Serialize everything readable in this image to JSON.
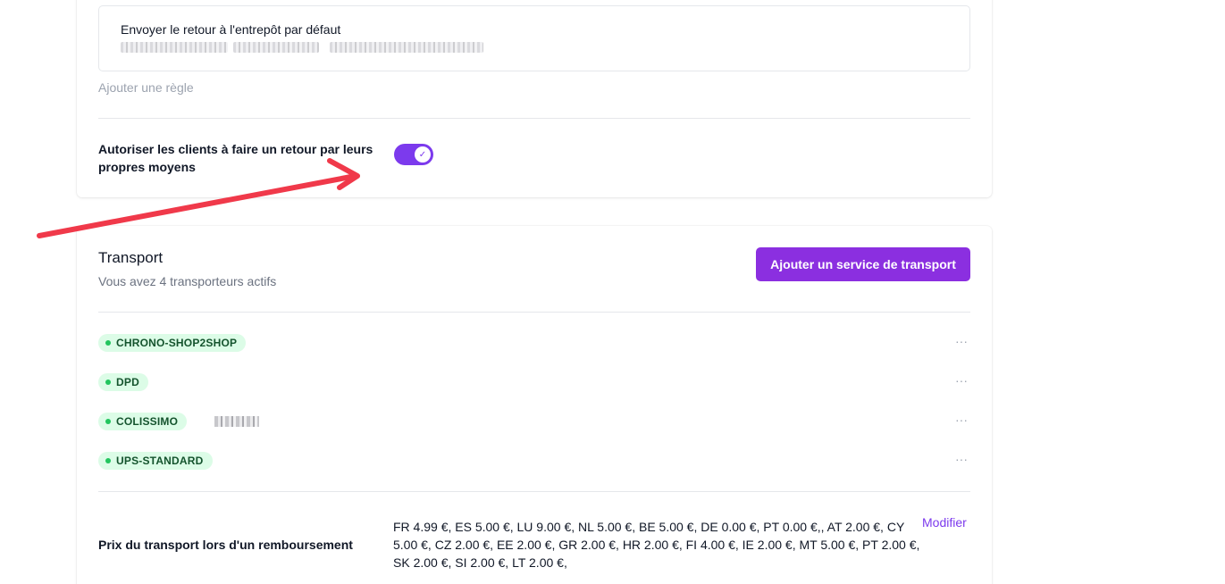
{
  "returns": {
    "rule_title": "Envoyer le retour à l'entrepôt par défaut",
    "add_rule_label": "Ajouter une règle",
    "own_means_label": "Autoriser les clients à faire un retour par leurs propres moyens",
    "own_means_enabled": true
  },
  "transport": {
    "title": "Transport",
    "subtitle": "Vous avez 4 transporteurs actifs",
    "add_button_label": "Ajouter un service de transport",
    "carriers": [
      {
        "name": "CHRONO-SHOP2SHOP",
        "more": "···"
      },
      {
        "name": "DPD",
        "more": "···"
      },
      {
        "name": "COLISSIMO",
        "more": "···"
      },
      {
        "name": "UPS-STANDARD",
        "more": "···"
      }
    ],
    "refund_price_label": "Prix du transport lors d'un remboursement",
    "refund_price_values": "FR 4.99 €, ES 5.00 €, LU 9.00 €, NL 5.00 €, BE 5.00 €, DE 0.00 €, PT 0.00 €,, AT 2.00 €, CY 5.00 €, CZ 2.00 €, EE 2.00 €, GR 2.00 €, HR 2.00 €, FI 4.00 €, IE 2.00 €, MT 5.00 €, PT 2.00 €, SK 2.00 €, SI 2.00 €, LT 2.00 €,",
    "modify_label": "Modifier"
  },
  "colors": {
    "accent": "#8b2fe0",
    "badge_bg": "#dcfce7",
    "badge_dot": "#22c55e",
    "annotation_arrow": "#f0394a"
  },
  "icons": {
    "toggle_check": "check-icon",
    "row_menu": "ellipsis-icon",
    "annotation": "red-arrow-annotation"
  }
}
